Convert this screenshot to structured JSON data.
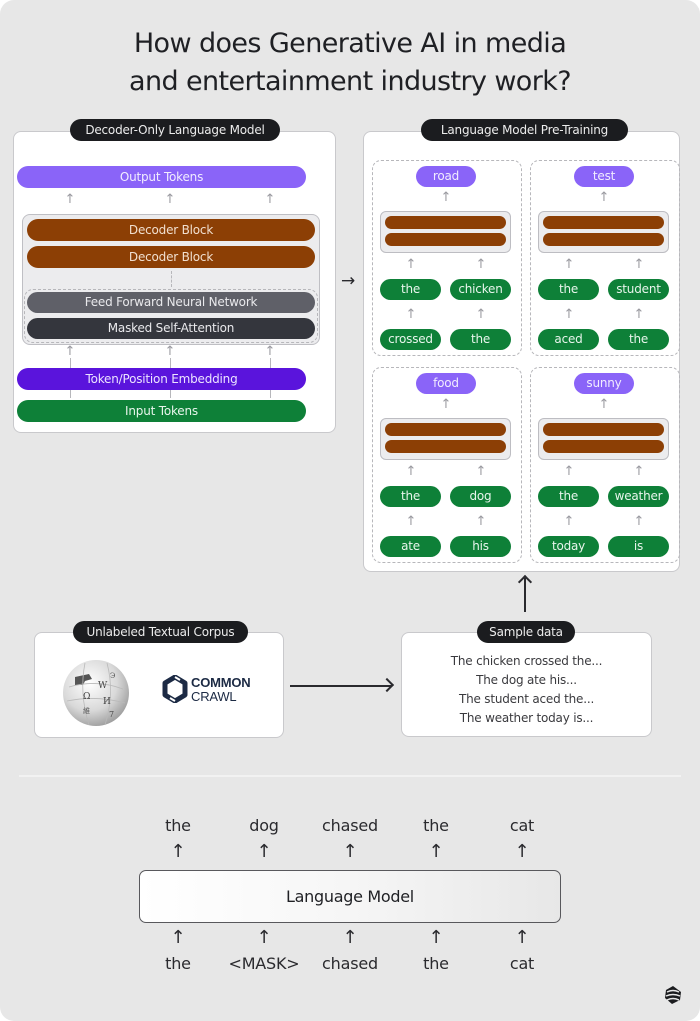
{
  "title": {
    "line1": "How does Generative AI in media",
    "line2": "and entertainment industry work?"
  },
  "decoder_panel": {
    "tag": "Decoder-Only Language Model",
    "output_tokens": "Output Tokens",
    "decoder_blocks": [
      "Decoder Block",
      "Decoder Block"
    ],
    "feed_forward": "Feed Forward Neural Network",
    "masked_attention": "Masked Self-Attention",
    "embedding": "Token/Position Embedding",
    "input_tokens": "Input Tokens",
    "colors": {
      "output": "#8a64f8",
      "decoder": "#8c3f05",
      "feed_forward": "#5f6068",
      "attention": "#34363d",
      "embedding": "#5a14dc",
      "input": "#0e8038"
    }
  },
  "flow_arrow": "→",
  "pretraining_panel": {
    "tag": "Language Model Pre-Training",
    "examples": [
      {
        "prediction": "road",
        "middle": [
          "the",
          "chicken"
        ],
        "inputs": [
          "crossed",
          "the"
        ]
      },
      {
        "prediction": "test",
        "middle": [
          "the",
          "student"
        ],
        "inputs": [
          "aced",
          "the"
        ]
      },
      {
        "prediction": "food",
        "middle": [
          "the",
          "dog"
        ],
        "inputs": [
          "ate",
          "his"
        ]
      },
      {
        "prediction": "sunny",
        "middle": [
          "the",
          "weather"
        ],
        "inputs": [
          "today",
          "is"
        ]
      }
    ]
  },
  "corpus_panel": {
    "tag": "Unlabeled Textual Corpus",
    "logos": [
      "wikipedia-logo",
      "common-crawl-logo"
    ],
    "common_crawl_line1": "COMMON",
    "common_crawl_line2": "CRAWL"
  },
  "sample_panel": {
    "tag": "Sample data",
    "lines": [
      "The chicken crossed the...",
      "The dog ate his...",
      "The student aced the...",
      "The weather today is..."
    ]
  },
  "masked_lm": {
    "model_label": "Language Model",
    "outputs": [
      "the",
      "dog",
      "chased",
      "the",
      "cat"
    ],
    "inputs": [
      "the",
      "<MASK>",
      "chased",
      "the",
      "cat"
    ],
    "arrow": "↑"
  },
  "icons": {
    "small_arrow": "↑"
  }
}
